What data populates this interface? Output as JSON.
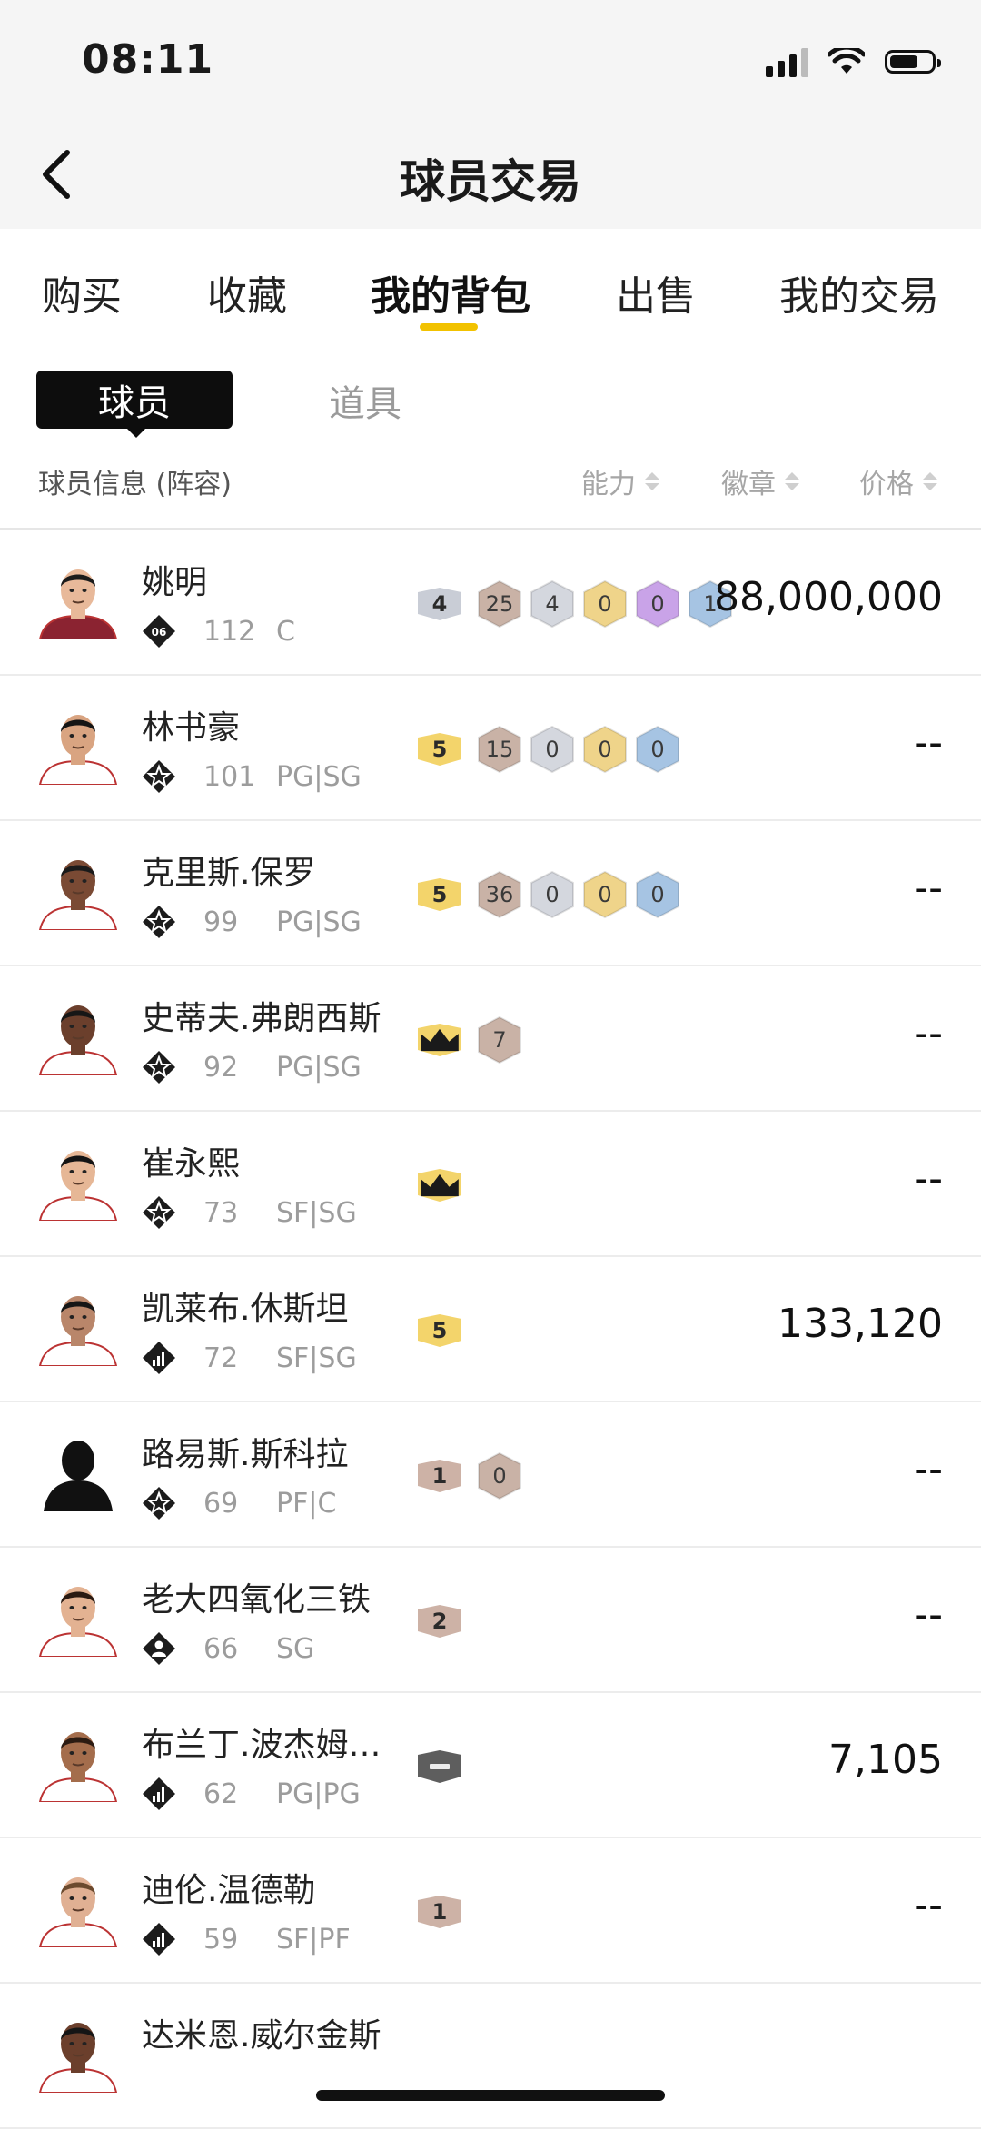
{
  "status_bar": {
    "time": "08:11"
  },
  "header": {
    "title": "球员交易"
  },
  "tabs": [
    {
      "label": "购买",
      "active": false
    },
    {
      "label": "收藏",
      "active": false
    },
    {
      "label": "我的背包",
      "active": true
    },
    {
      "label": "出售",
      "active": false
    },
    {
      "label": "我的交易",
      "active": false
    }
  ],
  "sub_tabs": [
    {
      "label": "球员",
      "active": true
    },
    {
      "label": "道具",
      "active": false
    }
  ],
  "columns": {
    "info": "球员信息 (阵容)",
    "ability": "能力",
    "badges": "徽章",
    "price": "价格"
  },
  "colors": {
    "accent": "#f2c200",
    "ability_yellow": "#f3d46b",
    "ability_silver": "#c9cdd6",
    "ability_bronze": "#cdb2a6",
    "ability_dark": "#5e5e5e",
    "badge_bronze": "#c9b2a6",
    "badge_silver": "#d4d7de",
    "badge_gold": "#efd48a",
    "badge_purple": "#c9a3e8",
    "badge_blue": "#a6c4e3"
  },
  "players": [
    {
      "name": "姚明",
      "type_icon": "shield-06-icon",
      "type_label": "06",
      "rating": "112",
      "position": "C",
      "ability": {
        "label": "4",
        "tier": "silver"
      },
      "badges": [
        {
          "label": "25",
          "tier": "bronze"
        },
        {
          "label": "4",
          "tier": "silver"
        },
        {
          "label": "0",
          "tier": "gold"
        },
        {
          "label": "0",
          "tier": "purple"
        },
        {
          "label": "1",
          "tier": "blue"
        }
      ],
      "price": "88,000,000",
      "avatar": "player-face",
      "skin": "#e8b99a",
      "hair": "#1b1b1b",
      "jersey": "#8b2331"
    },
    {
      "name": "林书豪",
      "type_icon": "star-icon",
      "type_label": "",
      "rating": "101",
      "position": "PG|SG",
      "ability": {
        "label": "5",
        "tier": "yellow"
      },
      "badges": [
        {
          "label": "15",
          "tier": "bronze"
        },
        {
          "label": "0",
          "tier": "silver"
        },
        {
          "label": "0",
          "tier": "gold"
        },
        {
          "label": "0",
          "tier": "blue"
        }
      ],
      "price": "--",
      "avatar": "player-face",
      "skin": "#d9a481",
      "hair": "#151515",
      "jersey": "#ffffff"
    },
    {
      "name": "克里斯.保罗",
      "type_icon": "star-icon",
      "type_label": "",
      "rating": "99",
      "position": "PG|SG",
      "ability": {
        "label": "5",
        "tier": "yellow"
      },
      "badges": [
        {
          "label": "36",
          "tier": "bronze"
        },
        {
          "label": "0",
          "tier": "silver"
        },
        {
          "label": "0",
          "tier": "gold"
        },
        {
          "label": "0",
          "tier": "blue"
        }
      ],
      "price": "--",
      "avatar": "player-face",
      "skin": "#7a4a34",
      "hair": "#1a1a1a",
      "jersey": "#ffffff"
    },
    {
      "name": "史蒂夫.弗朗西斯",
      "type_icon": "star-icon",
      "type_label": "",
      "rating": "92",
      "position": "PG|SG",
      "ability": {
        "label": "crown",
        "tier": "yellow"
      },
      "badges": [
        {
          "label": "7",
          "tier": "bronze"
        }
      ],
      "price": "--",
      "avatar": "player-face",
      "skin": "#6b3f2c",
      "hair": "#161616",
      "jersey": "#ffffff"
    },
    {
      "name": "崔永熙",
      "type_icon": "star-icon",
      "type_label": "",
      "rating": "73",
      "position": "SF|SG",
      "ability": {
        "label": "crown",
        "tier": "yellow"
      },
      "badges": [],
      "price": "--",
      "avatar": "player-face",
      "skin": "#e6b796",
      "hair": "#141414",
      "jersey": "#ffffff"
    },
    {
      "name": "凯莱布.休斯坦",
      "type_icon": "bars-icon",
      "type_label": "",
      "rating": "72",
      "position": "SF|SG",
      "ability": {
        "label": "5",
        "tier": "yellow"
      },
      "badges": [],
      "price": "133,120",
      "avatar": "player-face",
      "skin": "#b9866a",
      "hair": "#161616",
      "jersey": "#ffffff"
    },
    {
      "name": "路易斯.斯科拉",
      "type_icon": "star-icon",
      "type_label": "",
      "rating": "69",
      "position": "PF|C",
      "ability": {
        "label": "1",
        "tier": "bronze"
      },
      "badges": [
        {
          "label": "0",
          "tier": "bronze"
        }
      ],
      "price": "--",
      "avatar": "silhouette",
      "skin": "#111111",
      "hair": "#111111",
      "jersey": "#111111"
    },
    {
      "name": "老大四氧化三铁",
      "type_icon": "person-icon",
      "type_label": "",
      "rating": "66",
      "position": "SG",
      "ability": {
        "label": "2",
        "tier": "bronze"
      },
      "badges": [],
      "price": "--",
      "avatar": "player-face",
      "skin": "#e3b292",
      "hair": "#2a1a12",
      "jersey": "#ffffff"
    },
    {
      "name": "布兰丁.波杰姆…",
      "type_icon": "bars-icon",
      "type_label": "",
      "rating": "62",
      "position": "PG|PG",
      "ability": {
        "label": "minus",
        "tier": "dark"
      },
      "badges": [],
      "price": "7,105",
      "avatar": "player-face",
      "skin": "#a46d4c",
      "hair": "#2b1b12",
      "jersey": "#ffffff"
    },
    {
      "name": "迪伦.温德勒",
      "type_icon": "bars-icon",
      "type_label": "",
      "rating": "59",
      "position": "SF|PF",
      "ability": {
        "label": "1",
        "tier": "bronze"
      },
      "badges": [],
      "price": "--",
      "avatar": "player-face",
      "skin": "#e0b093",
      "hair": "#6b4a2e",
      "jersey": "#ffffff"
    },
    {
      "name": "达米恩.威尔金斯",
      "type_icon": "bars-icon",
      "type_label": "",
      "rating": "",
      "position": "",
      "ability": {
        "label": "",
        "tier": "none"
      },
      "badges": [],
      "price": "",
      "avatar": "player-face",
      "skin": "#6b3f2c",
      "hair": "#151515",
      "jersey": "#ffffff"
    }
  ]
}
